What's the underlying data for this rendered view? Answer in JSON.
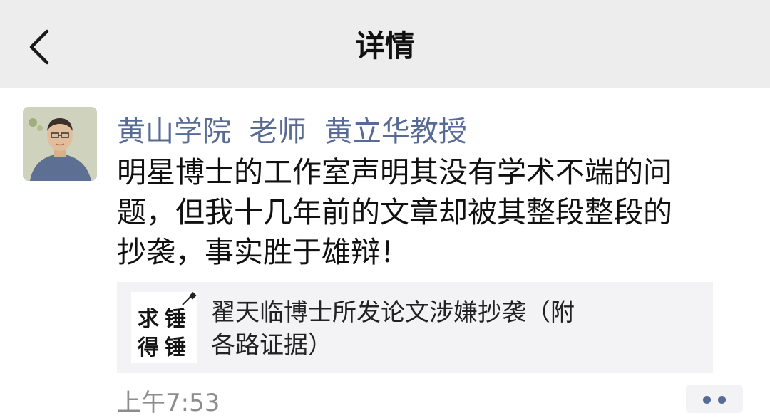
{
  "header": {
    "title": "详情",
    "back_icon": "chevron-left-icon"
  },
  "post": {
    "author": "黄山学院  老师  黄立华教授",
    "text_lines": [
      "明星博士的工作室声明其没有学术不端的问",
      "题，但我十几年前的文章却被其整段整段的",
      "抄袭，事实胜于雄辩！"
    ],
    "link_card": {
      "logo_chars": [
        "求",
        "锤",
        "得",
        "锤"
      ],
      "title_lines": [
        "翟天临博士所发论文涉嫌抄袭（附",
        "各路证据）"
      ]
    },
    "time": "上午7:53",
    "more_icon": "more-dots-icon"
  },
  "colors": {
    "nav_bg": "#ededed",
    "author_name": "#576b95",
    "card_bg": "#f3f3f5",
    "timestamp": "#8c8c8c"
  }
}
